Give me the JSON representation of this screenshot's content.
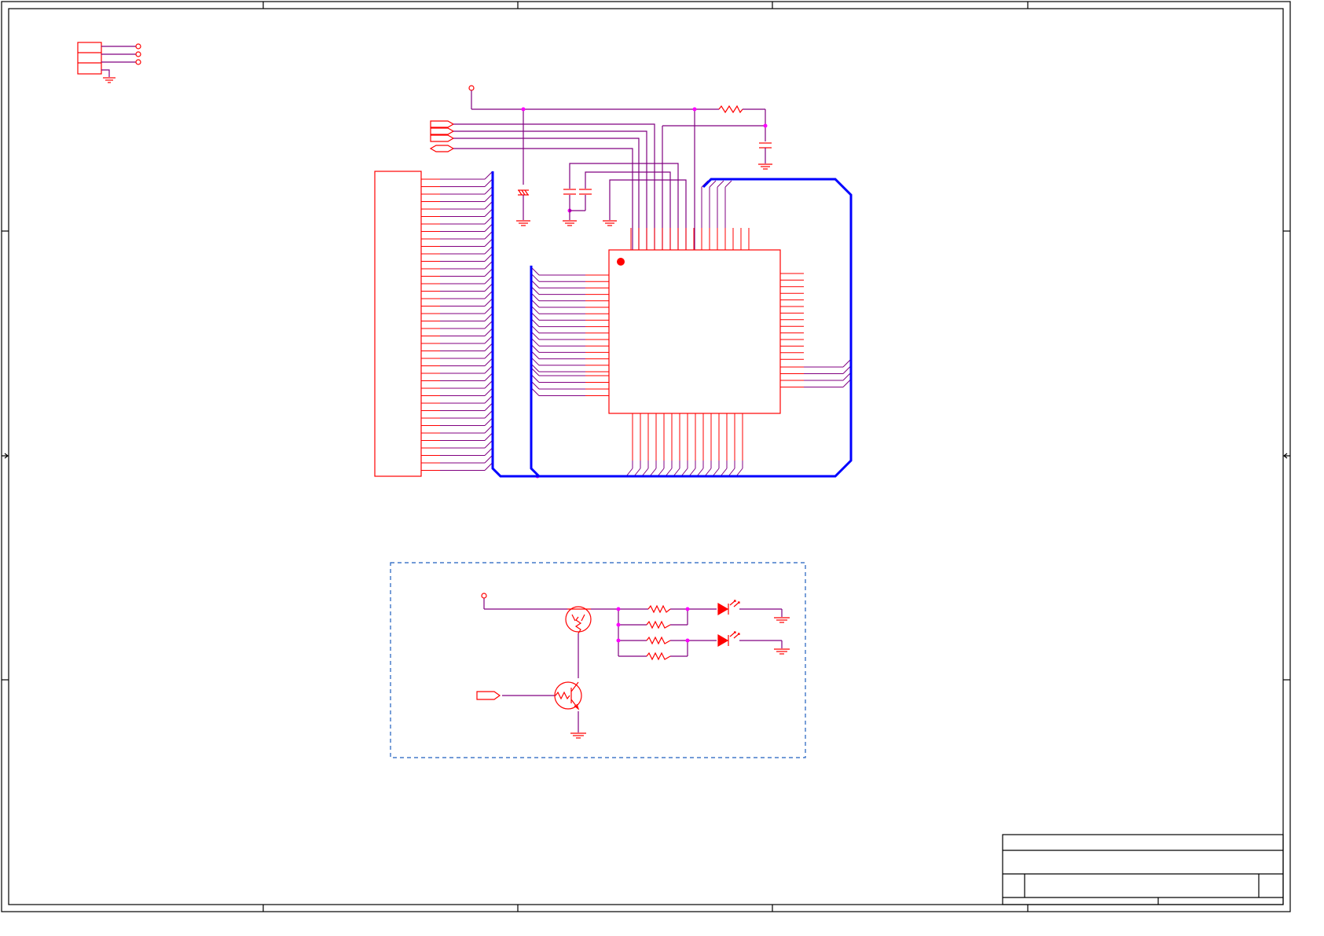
{
  "colors": {
    "frame": "#000000",
    "component": "#ff0000",
    "wire": "#800080",
    "bus": "#0000ff",
    "junction": "#ff00ff",
    "group_box": "#1f5fbf"
  }
}
